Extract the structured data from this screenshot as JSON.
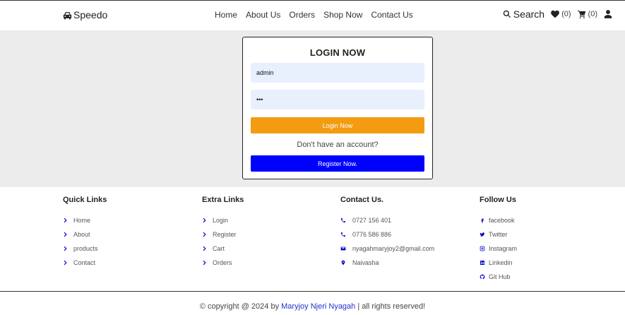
{
  "header": {
    "brand": "Speedo",
    "nav": [
      "Home",
      "About Us",
      "Orders",
      "Shop Now",
      "Contact Us"
    ],
    "search_label": "Search",
    "wishlist_count": "(0)",
    "cart_count": "(0)"
  },
  "login": {
    "title": "LOGIN NOW",
    "username_value": "admin",
    "password_value": "•••",
    "login_button": "Login Now",
    "no_account_text": "Don't have an account?",
    "register_button": "Register Now."
  },
  "footer": {
    "quick_links": {
      "title": "Quick Links",
      "items": [
        "Home",
        "About",
        "products",
        "Contact"
      ]
    },
    "extra_links": {
      "title": "Extra Links",
      "items": [
        "Login",
        "Register",
        "Cart",
        "Orders"
      ]
    },
    "contact": {
      "title": "Contact Us.",
      "phone1": "0727 156 401",
      "phone2": "0776 586 886",
      "email": "nyagahmaryjoy2@gmail.com",
      "location": "Naivasha"
    },
    "follow": {
      "title": "Follow Us",
      "items": [
        "facebook",
        "Twitter",
        "Instagram",
        "Linkedin",
        "Git Hub"
      ]
    },
    "copyright_prefix": "© copyright @ 2024 by ",
    "copyright_author": "Maryjoy Njeri Nyagah",
    "copyright_suffix": " | all rights reserved!"
  },
  "colors": {
    "accent_orange": "#f39c12",
    "accent_blue": "#0000ff",
    "input_bg": "#e8f0fe",
    "main_bg": "#ececec"
  }
}
